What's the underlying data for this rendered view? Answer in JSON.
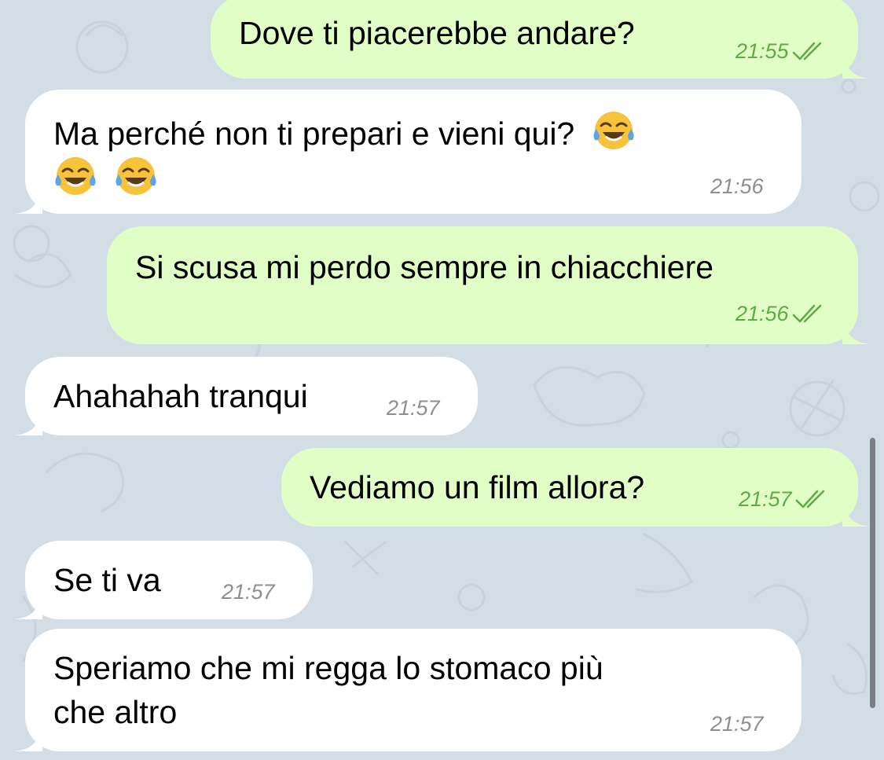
{
  "colors": {
    "wallpaper": "#d3dde6",
    "incoming_bubble": "#ffffff",
    "outgoing_bubble": "#e1fec6",
    "outgoing_meta": "#5faa47",
    "incoming_meta": "#8e8e93"
  },
  "messages": [
    {
      "direction": "outgoing",
      "text": "Dove ti piacerebbe andare?",
      "time": "21:55",
      "status": "read-double-check-icon"
    },
    {
      "direction": "incoming",
      "text_line1": "Ma perché non ti prepari e vieni qui?",
      "emoji": "face-with-tears-of-joy-icon",
      "time": "21:56"
    },
    {
      "direction": "outgoing",
      "text": "Si scusa mi perdo sempre in chiacchiere",
      "time": "21:56",
      "status": "read-double-check-icon"
    },
    {
      "direction": "incoming",
      "text": "Ahahahah tranqui",
      "time": "21:57"
    },
    {
      "direction": "outgoing",
      "text": "Vediamo un film allora?",
      "time": "21:57",
      "status": "read-double-check-icon"
    },
    {
      "direction": "incoming",
      "text": "Se ti va",
      "time": "21:57"
    },
    {
      "direction": "incoming",
      "text_line1": "Speriamo che mi regga lo stomaco più",
      "text_line2": "che altro",
      "time": "21:57"
    }
  ]
}
